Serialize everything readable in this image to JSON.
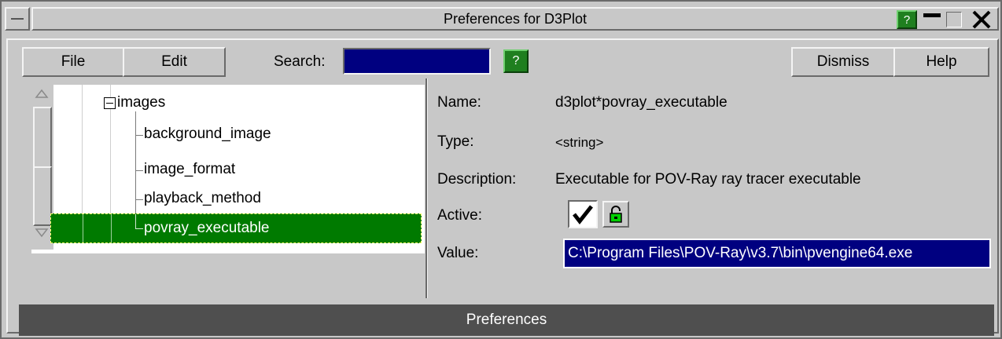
{
  "window": {
    "title": "Preferences for D3Plot",
    "help_badge": "?"
  },
  "menubar": {
    "file_label": "File",
    "edit_label": "Edit",
    "search_label": "Search:",
    "search_value": "",
    "search_help": "?",
    "dismiss_label": "Dismiss",
    "help_label": "Help"
  },
  "tree": {
    "parent": "images",
    "children": [
      {
        "label": "background_image",
        "selected": false
      },
      {
        "label": "image_format",
        "selected": false
      },
      {
        "label": "playback_method",
        "selected": false
      },
      {
        "label": "povray_executable",
        "selected": true
      }
    ]
  },
  "details": {
    "name_label": "Name:",
    "name_value": "d3plot*povray_executable",
    "type_label": "Type:",
    "type_value": "<string>",
    "description_label": "Description:",
    "description_value": "Executable for POV-Ray ray tracer executable",
    "active_label": "Active:",
    "active_checked": true,
    "value_label": "Value:",
    "value_value": "C:\\Program Files\\POV-Ray\\v3.7\\bin\\pvengine64.exe"
  },
  "footer": {
    "label": "Preferences"
  },
  "colors": {
    "selection_green": "#007a00",
    "value_blue": "#000080",
    "footer_gray": "#4f4f4f"
  }
}
